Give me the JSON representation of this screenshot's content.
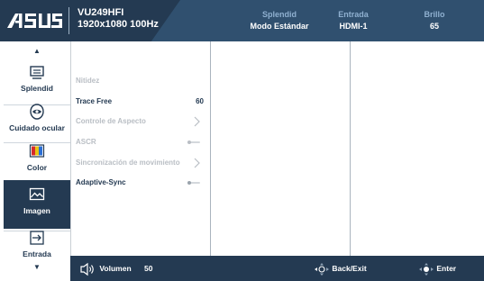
{
  "header": {
    "brand": "/ISUS",
    "model": "VU249HFI",
    "resolution": "1920x1080 100Hz",
    "stats": [
      {
        "label": "Splendid",
        "value": "Modo Estándar"
      },
      {
        "label": "Entrada",
        "value": "HDMI-1"
      },
      {
        "label": "Brillo",
        "value": "65"
      }
    ]
  },
  "sidebar": {
    "items": [
      {
        "label": "Splendid",
        "icon": "splendid-icon"
      },
      {
        "label": "Cuidado ocular",
        "icon": "eye-care-icon"
      },
      {
        "label": "Color",
        "icon": "color-bars-icon"
      },
      {
        "label": "Imagen",
        "icon": "image-icon",
        "active": true
      },
      {
        "label": "Entrada",
        "icon": "input-icon"
      }
    ]
  },
  "menu": {
    "items": [
      {
        "label": "Nitidez",
        "enabled": false
      },
      {
        "label": "Trace Free",
        "value": "60",
        "enabled": true
      },
      {
        "label": "Controle de Aspecto",
        "enabled": false
      },
      {
        "label": "ASCR",
        "enabled": false
      },
      {
        "label": "Sincronización de movimiento",
        "enabled": false
      },
      {
        "label": "Adaptive-Sync",
        "enabled": true
      }
    ]
  },
  "footer": {
    "volume_label": "Volumen",
    "volume_value": "50",
    "back_label": "Back/Exit",
    "enter_label": "Enter"
  },
  "colors": {
    "header_bg": "#243a52",
    "accent": "#8fb0d0",
    "disabled_text": "#b9bec4"
  }
}
